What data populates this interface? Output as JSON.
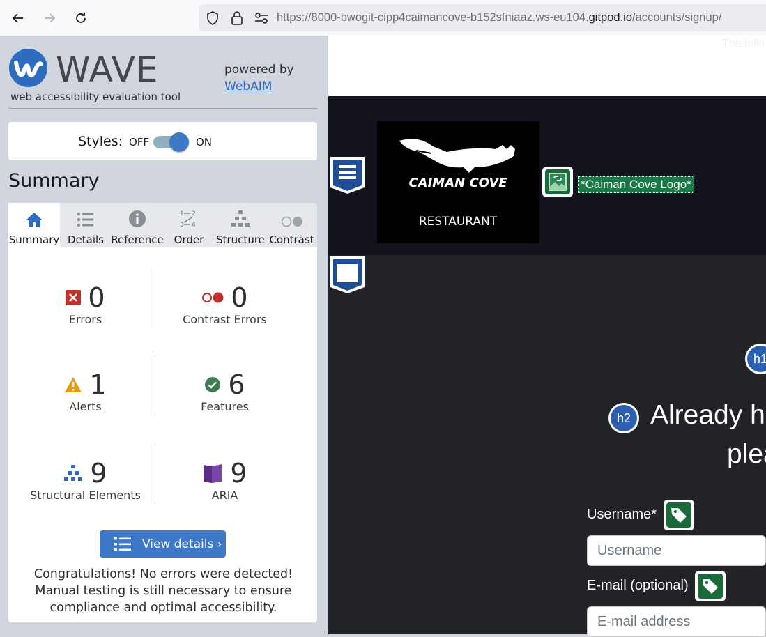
{
  "browser": {
    "url_prefix": "https://8000-bwogit-cipp4caimancove-b152sfniaaz.ws-eu104.",
    "url_domain": "gitpod.io",
    "url_path": "/accounts/signup/"
  },
  "wave": {
    "logo_text": "WAVE",
    "tagline": "web accessibility evaluation tool",
    "powered_by": "powered by",
    "webaim_link": "WebAIM",
    "styles_label": "Styles:",
    "styles_off": "OFF",
    "styles_on": "ON",
    "styles_enabled": true,
    "summary_title": "Summary",
    "tabs": [
      {
        "label": "Summary",
        "icon": "home-icon",
        "active": true
      },
      {
        "label": "Details",
        "icon": "list-icon",
        "active": false
      },
      {
        "label": "Reference",
        "icon": "info-icon",
        "active": false
      },
      {
        "label": "Order",
        "icon": "order-icon",
        "active": false
      },
      {
        "label": "Structure",
        "icon": "structure-icon",
        "active": false
      },
      {
        "label": "Contrast",
        "icon": "contrast-icon",
        "active": false
      }
    ],
    "stats": {
      "errors": {
        "count": "0",
        "label": "Errors"
      },
      "contrast_errors": {
        "count": "0",
        "label": "Contrast Errors"
      },
      "alerts": {
        "count": "1",
        "label": "Alerts"
      },
      "features": {
        "count": "6",
        "label": "Features"
      },
      "structural": {
        "count": "9",
        "label": "Structural Elements"
      },
      "aria": {
        "count": "9",
        "label": "ARIA"
      }
    },
    "view_details": "View details ›",
    "congrats": "Congratulations! No errors were detected! Manual testing is still necessary to ensure compliance and optimal accessibility."
  },
  "page": {
    "top_text": "The follo",
    "logo_title": "CAIMAN COVE",
    "logo_subtitle": "RESTAURANT",
    "logo_alt_label": "*Caiman Cove Logo*",
    "h1_badge": "h1",
    "h2_badge": "h2",
    "heading_line1": "Already h",
    "heading_line2": "plea",
    "username_label": "Username*",
    "username_placeholder": "Username",
    "email_label": "E-mail (optional)",
    "email_placeholder": "E-mail address"
  },
  "colors": {
    "wave_blue": "#2e6cc0",
    "feature_green": "#1b6b3a",
    "error_red": "#c0312b",
    "alert_orange": "#e49a0d",
    "aria_purple": "#5b2d82"
  }
}
